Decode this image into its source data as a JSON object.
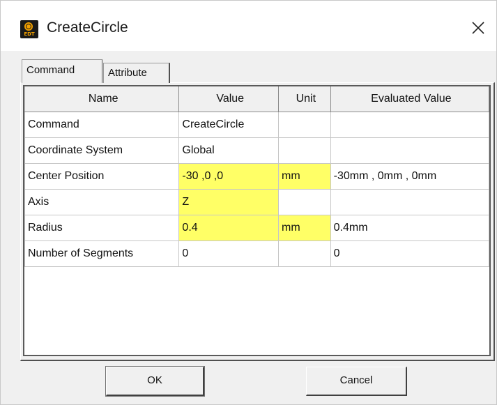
{
  "window": {
    "title": "CreateCircle",
    "app_icon_text": "EDT"
  },
  "tabs": [
    {
      "label": "Command",
      "selected": true
    },
    {
      "label": "Attribute",
      "selected": false
    }
  ],
  "grid": {
    "columns": [
      "Name",
      "Value",
      "Unit",
      "Evaluated Value"
    ],
    "rows": [
      {
        "name": "Command",
        "value": "CreateCircle",
        "unit": "",
        "evaluated": ""
      },
      {
        "name": "Coordinate System",
        "value": "Global",
        "unit": "",
        "evaluated": ""
      },
      {
        "name": "Center Position",
        "value": "-30 ,0 ,0",
        "unit": "mm",
        "evaluated": "-30mm , 0mm , 0mm"
      },
      {
        "name": "Axis",
        "value": "Z",
        "unit": "",
        "evaluated": ""
      },
      {
        "name": "Radius",
        "value": "0.4",
        "unit": "mm",
        "evaluated": "0.4mm"
      },
      {
        "name": "Number of Segments",
        "value": "0",
        "unit": "",
        "evaluated": "0"
      }
    ],
    "highlight_color": "#ffff66"
  },
  "buttons": {
    "ok": "OK",
    "cancel": "Cancel"
  }
}
